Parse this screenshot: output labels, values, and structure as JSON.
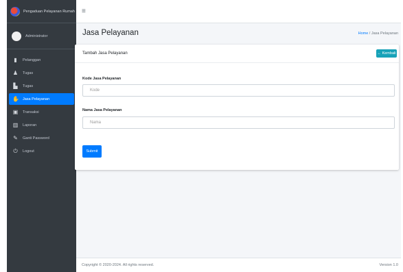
{
  "sidebar": {
    "brand_text": "Pengaduan Pelayanan Rumah",
    "user_name": "Administrator",
    "items": [
      {
        "label": "Pelanggan",
        "icon": "document-icon"
      },
      {
        "label": "Tugas",
        "icon": "user-icon"
      },
      {
        "label": "Tugas",
        "icon": "tasks-icon"
      },
      {
        "label": "Jasa Pelayanan",
        "icon": "hand-icon",
        "active": true
      },
      {
        "label": "Transaksi",
        "icon": "card-icon"
      },
      {
        "label": "Laporan",
        "icon": "book-icon"
      },
      {
        "label": "Ganti Password",
        "icon": "pencil-icon"
      },
      {
        "label": "Logout",
        "icon": "power-icon"
      }
    ]
  },
  "topbar": {
    "menu_icon": "≡"
  },
  "header": {
    "title": "Jasa Pelayanan",
    "breadcrumb_home": "Home",
    "breadcrumb_sep": " / ",
    "breadcrumb_current": "Jasa Pelayanan"
  },
  "card": {
    "title": "Tambah Jasa Pelayanan",
    "back_label": "← Kembali",
    "fields": [
      {
        "label": "Kode Jasa Pelayanan",
        "placeholder": "Kode"
      },
      {
        "label": "Nama Jasa Pelayanan",
        "placeholder": "Nama"
      }
    ],
    "submit_label": "Submit"
  },
  "footer": {
    "copyright": "Copyright © 2020-2024. All rights reserved.",
    "version": "Version 1.0"
  },
  "colors": {
    "sidebar": "#343a40",
    "primary": "#007bff",
    "info": "#17a2b8"
  }
}
